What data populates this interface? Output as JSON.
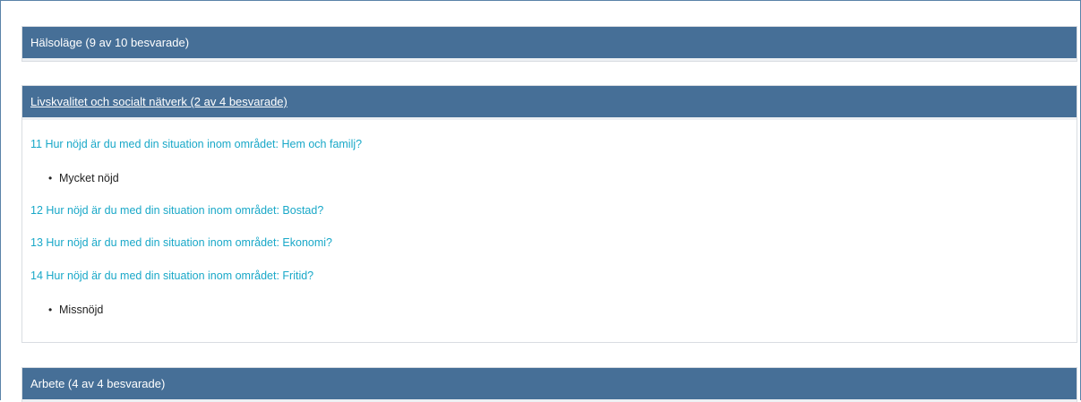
{
  "sections": {
    "halsolage": {
      "title": "Hälsoläge (9 av 10 besvarade)"
    },
    "livskvalitet": {
      "title": "Livskvalitet och socialt nätverk (2 av 4 besvarade)",
      "questions": [
        {
          "text": "11 Hur nöjd är du med din situation inom området: Hem och familj?",
          "answer": "Mycket nöjd"
        },
        {
          "text": "12 Hur nöjd är du med din situation inom området: Bostad?",
          "answer": ""
        },
        {
          "text": "13 Hur nöjd är du med din situation inom området: Ekonomi?",
          "answer": ""
        },
        {
          "text": "14 Hur nöjd är du med din situation inom området: Fritid?",
          "answer": "Missnöjd"
        }
      ]
    },
    "arbete": {
      "title": "Arbete (4 av 4 besvarade)"
    }
  },
  "icons": {
    "bullet": "•"
  },
  "colors": {
    "header_bg": "#466f97",
    "question_link": "#19a8c8",
    "frame_border": "#5a83a8"
  }
}
